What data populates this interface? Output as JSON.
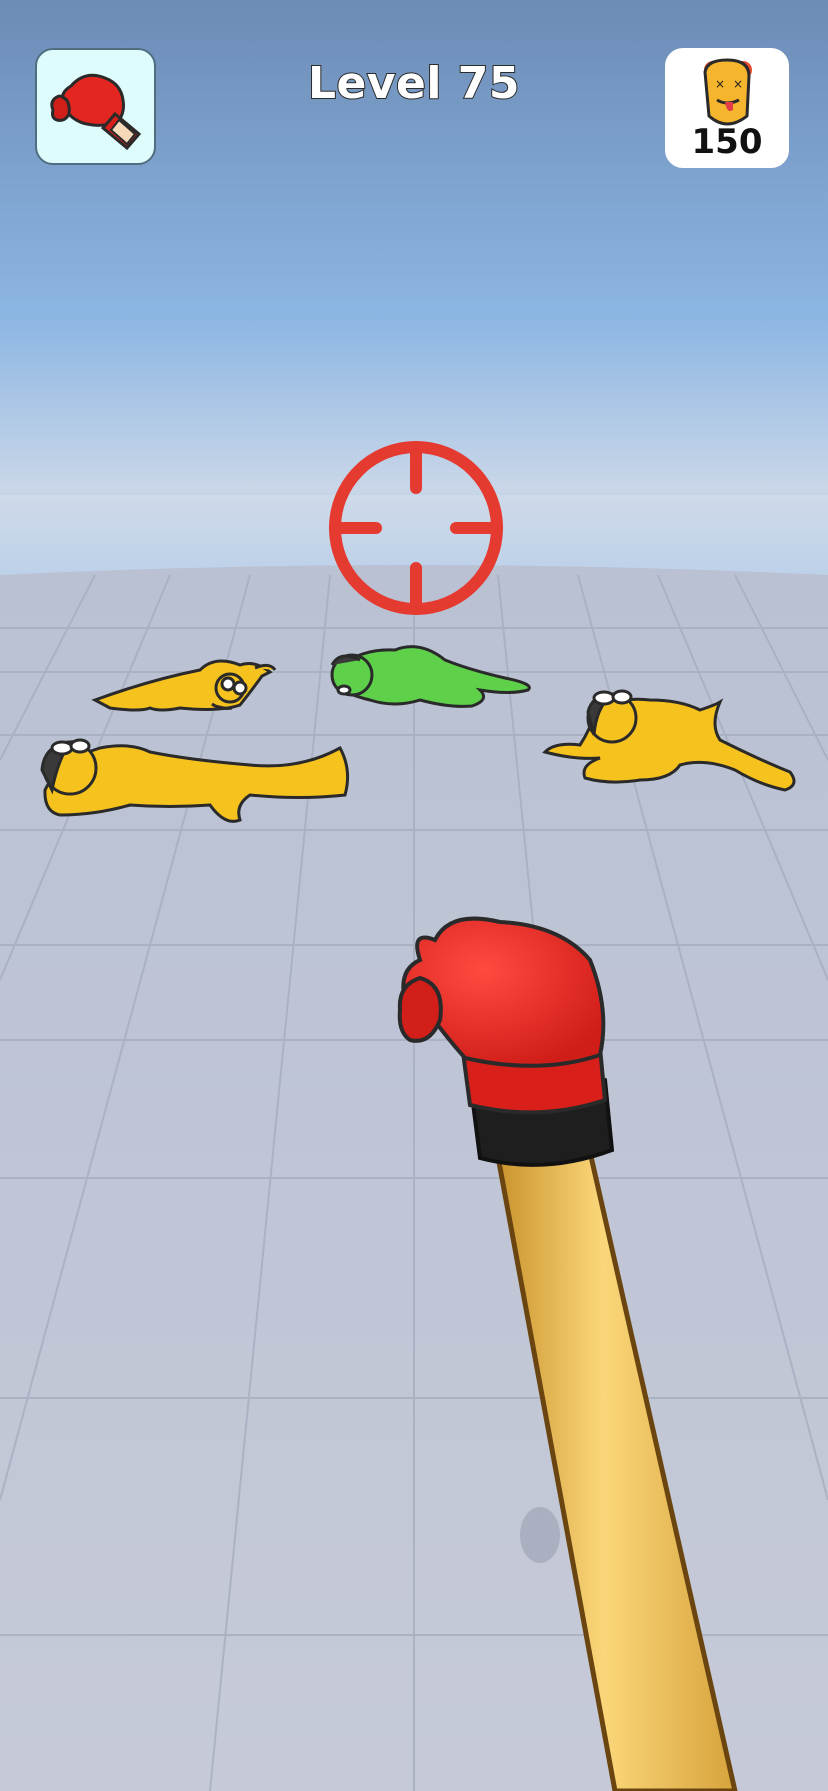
{
  "hud": {
    "level_label": "Level 75",
    "score_value": "150",
    "weapon_icon": "boxing-glove-icon",
    "score_icon": "knocked-out-face-icon"
  },
  "colors": {
    "sky_top": "#6a8db8",
    "sky_bottom": "#a8ccef",
    "floor": "#c3c8d6",
    "crosshair": "#e53a2f",
    "enemy_yellow": "#f6c21e",
    "enemy_green": "#5ed04a",
    "glove_red": "#ee2a24",
    "pole": "#e3b54a"
  }
}
